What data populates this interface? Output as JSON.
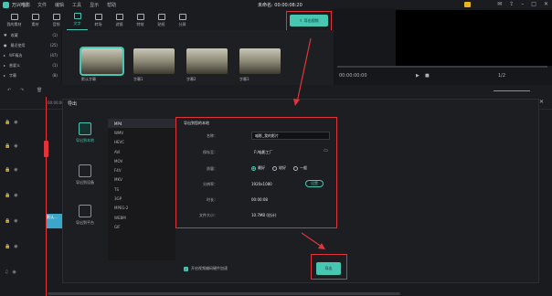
{
  "app": {
    "name": "万兴喵影",
    "menus": [
      "文件",
      "编辑",
      "工具",
      "显示",
      "帮助"
    ],
    "project_title": "未命名: 00:00:08:20"
  },
  "toolbar": {
    "items": [
      "我的素材",
      "素材",
      "音频",
      "文字",
      "转场",
      "滤镜",
      "特效",
      "贴纸",
      "分屏"
    ],
    "active_index": 3,
    "export_label": "导出视频"
  },
  "sidebar": {
    "items": [
      {
        "label": "收藏",
        "count": "(1)"
      },
      {
        "label": "最近使用",
        "count": "(25)"
      },
      {
        "label": "WF精选",
        "count": "(47)"
      },
      {
        "label": "普要义",
        "count": "(1)"
      },
      {
        "label": "字幕",
        "count": "(8)"
      }
    ]
  },
  "media": {
    "thumbs": [
      {
        "label": "默认字幕"
      },
      {
        "label": "字幕1"
      },
      {
        "label": "字幕2"
      },
      {
        "label": "字幕3"
      }
    ]
  },
  "preview": {
    "time": "00:00:00:00",
    "zoom": "1/2"
  },
  "timeline": {
    "ruler_time": "00:00:00:00",
    "clip_label": "默认..."
  },
  "dialog": {
    "title": "导出",
    "panel_title": "导出到您的本地",
    "options": [
      {
        "label": "导出到本地"
      },
      {
        "label": "导出到设备"
      },
      {
        "label": "导出到平台"
      }
    ],
    "formats": [
      "MP4",
      "WMV",
      "HEVC",
      "AVI",
      "MOV",
      "F4V",
      "MKV",
      "TS",
      "3GP",
      "MPEG-2",
      "WEBM",
      "GIF"
    ],
    "selected_format": "MP4",
    "fields": {
      "name_label": "名称：",
      "name_value": "喵影_我的影片",
      "save_label": "保存至：",
      "save_value": "F:/喵影工厂",
      "quality_label": "质量：",
      "quality_options": [
        "最好",
        "较好",
        "一般"
      ],
      "quality_selected": 0,
      "resolution_label": "分辨率：",
      "resolution_value": "1920x1080",
      "settings_btn": "设置",
      "duration_label": "时长：",
      "duration_value": "00:00:08",
      "size_label": "文件大小：",
      "size_value": "10.7MB (估计)"
    },
    "hw_accel_label": "开启视频编码硬件加速",
    "export_label": "导出"
  },
  "colors": {
    "accent": "#47c7b2",
    "highlight": "#e0343a"
  }
}
